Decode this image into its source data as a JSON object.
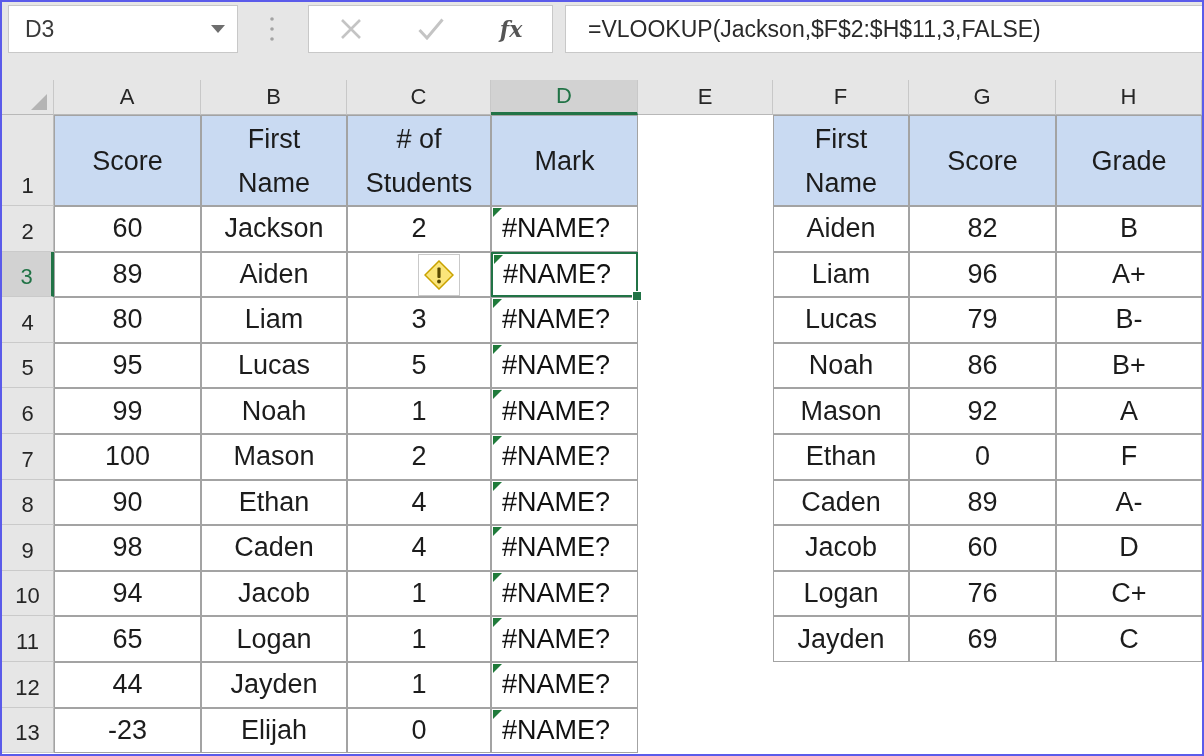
{
  "formula_bar": {
    "name_box": "D3",
    "editing": false,
    "function_label": "fx",
    "formula": "=VLOOKUP(Jackson,$F$2:$H$11,3,FALSE)"
  },
  "columns": [
    {
      "label": "A",
      "selected": false
    },
    {
      "label": "B",
      "selected": false
    },
    {
      "label": "C",
      "selected": false
    },
    {
      "label": "D",
      "selected": true
    },
    {
      "label": "E",
      "selected": false
    },
    {
      "label": "F",
      "selected": false
    },
    {
      "label": "G",
      "selected": false
    },
    {
      "label": "H",
      "selected": false
    }
  ],
  "row_numbers": [
    {
      "label": "1",
      "selected": false
    },
    {
      "label": "2",
      "selected": false
    },
    {
      "label": "3",
      "selected": true
    },
    {
      "label": "4",
      "selected": false
    },
    {
      "label": "5",
      "selected": false
    },
    {
      "label": "6",
      "selected": false
    },
    {
      "label": "7",
      "selected": false
    },
    {
      "label": "8",
      "selected": false
    },
    {
      "label": "9",
      "selected": false
    },
    {
      "label": "10",
      "selected": false
    },
    {
      "label": "11",
      "selected": false
    },
    {
      "label": "12",
      "selected": false
    },
    {
      "label": "13",
      "selected": false
    }
  ],
  "left_table": {
    "headers": [
      "Score",
      "First Name",
      "# of Students",
      "Mark"
    ],
    "rows": [
      {
        "score": "60",
        "first_name": "Jackson",
        "students": "2",
        "mark": "#NAME?",
        "flagged": true,
        "smart_tag": false
      },
      {
        "score": "89",
        "first_name": "Aiden",
        "mark": "#NAME?",
        "flagged": true,
        "smart_tag": true
      },
      {
        "score": "80",
        "first_name": "Liam",
        "students": "3",
        "mark": "#NAME?",
        "flagged": true,
        "smart_tag": false
      },
      {
        "score": "95",
        "first_name": "Lucas",
        "students": "5",
        "mark": "#NAME?",
        "flagged": true,
        "smart_tag": false
      },
      {
        "score": "99",
        "first_name": "Noah",
        "students": "1",
        "mark": "#NAME?",
        "flagged": true,
        "smart_tag": false
      },
      {
        "score": "100",
        "first_name": "Mason",
        "students": "2",
        "mark": "#NAME?",
        "flagged": true,
        "smart_tag": false
      },
      {
        "score": "90",
        "first_name": "Ethan",
        "students": "4",
        "mark": "#NAME?",
        "flagged": true,
        "smart_tag": false
      },
      {
        "score": "98",
        "first_name": "Caden",
        "students": "4",
        "mark": "#NAME?",
        "flagged": true,
        "smart_tag": false
      },
      {
        "score": "94",
        "first_name": "Jacob",
        "students": "1",
        "mark": "#NAME?",
        "flagged": true,
        "smart_tag": false
      },
      {
        "score": "65",
        "first_name": "Logan",
        "students": "1",
        "mark": "#NAME?",
        "flagged": true,
        "smart_tag": false
      },
      {
        "score": "44",
        "first_name": "Jayden",
        "students": "1",
        "mark": "#NAME?",
        "flagged": true,
        "smart_tag": false
      },
      {
        "score": "-23",
        "first_name": "Elijah",
        "students": "0",
        "mark": "#NAME?",
        "flagged": true,
        "smart_tag": false
      }
    ]
  },
  "right_table": {
    "headers": [
      "First Name",
      "Score",
      "Grade"
    ],
    "rows": [
      {
        "first_name": "Aiden",
        "score": "82",
        "grade": "B"
      },
      {
        "first_name": "Liam",
        "score": "96",
        "grade": "A+"
      },
      {
        "first_name": "Lucas",
        "score": "79",
        "grade": "B-"
      },
      {
        "first_name": "Noah",
        "score": "86",
        "grade": "B+"
      },
      {
        "first_name": "Mason",
        "score": "92",
        "grade": "A"
      },
      {
        "first_name": "Ethan",
        "score": "0",
        "grade": "F"
      },
      {
        "first_name": "Caden",
        "score": "89",
        "grade": "A-"
      },
      {
        "first_name": "Jacob",
        "score": "60",
        "grade": "D"
      },
      {
        "first_name": "Logan",
        "score": "76",
        "grade": "C+"
      },
      {
        "first_name": "Jayden",
        "score": "69",
        "grade": "C"
      }
    ]
  }
}
